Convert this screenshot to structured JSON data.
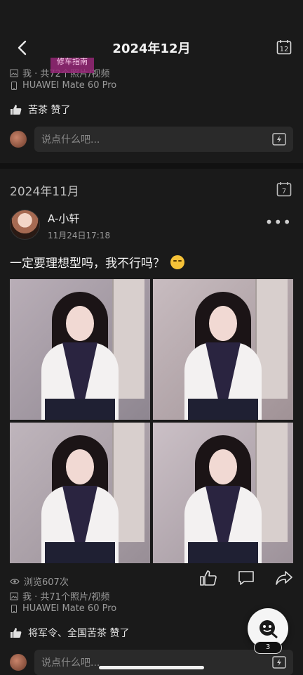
{
  "header": {
    "title": "2024年12月",
    "calendar_day": "12",
    "watermark": "修车指南"
  },
  "prev_post": {
    "photos_line": "我 · 共72个照片/视频",
    "device": "HUAWEI Mate 60 Pro",
    "likes": "苦茶 赞了",
    "comment_placeholder": "说点什么吧..."
  },
  "section": {
    "month": "2024年11月",
    "calendar_day": "7"
  },
  "post": {
    "username": "A-小轩",
    "time": "11月24日17:18",
    "text": "一定要理想型吗，我不行吗？",
    "views": "浏览607次",
    "photos_line": "我 · 共71个照片/视频",
    "device": "HUAWEI Mate 60 Pro",
    "likes": "将军令、全国苦茶 赞了",
    "comment_placeholder": "说点什么吧..."
  },
  "fab": {
    "badge": "3"
  },
  "colors": {
    "background": "#1a1a1a",
    "input_bg": "#2a2a2a",
    "secondary_text": "#9a9a9a"
  }
}
